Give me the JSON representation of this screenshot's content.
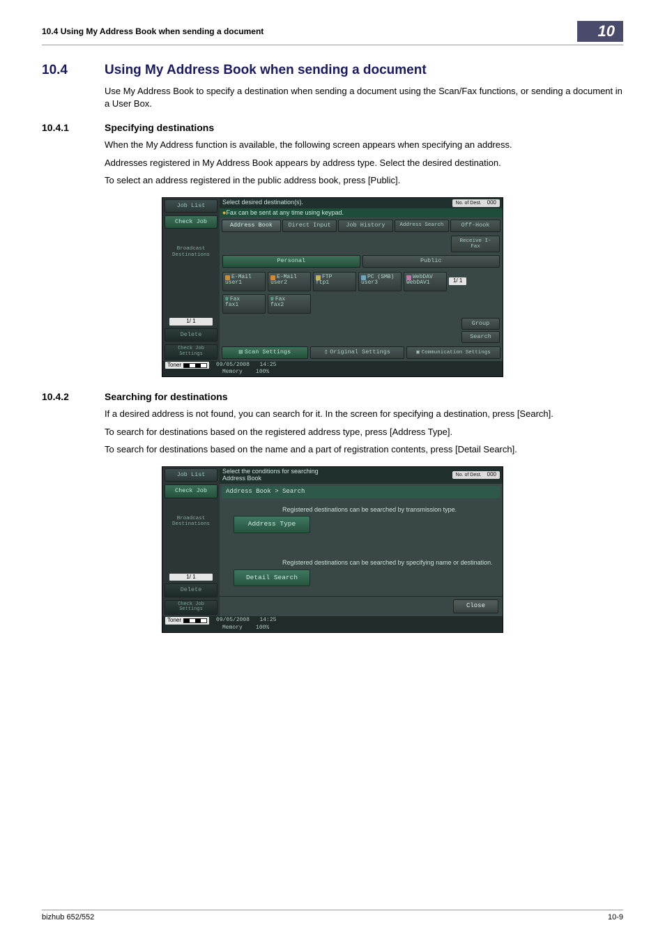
{
  "header": {
    "left": "10.4    Using My Address Book when sending a document",
    "badge": "10"
  },
  "section": {
    "num": "10.4",
    "title": "Using My Address Book when sending a document",
    "intro": "Use My Address Book to specify a destination when sending a document using the Scan/Fax functions, or sending a document in a User Box."
  },
  "sub1": {
    "num": "10.4.1",
    "title": "Specifying destinations",
    "p1": "When the My Address function is available, the following screen appears when specifying an address.",
    "p2": "Addresses registered in My Address Book appears by address type. Select the desired destination.",
    "p3": "To select an address registered in the public address book, press [Public]."
  },
  "screen1": {
    "topline": "Select desired destination(s).",
    "destLabel": "No. of Dest.",
    "destCount": "000",
    "banner": "Fax can be sent at any time using keypad.",
    "sidebar": {
      "jobList": "Job List",
      "checkJob": "Check Job",
      "broadcast": "Broadcast Destinations",
      "page": "1/  1",
      "delete": "Delete",
      "checkJobSettings": "Check Job Settings"
    },
    "tabs": {
      "addressBook": "Address Book",
      "directInput": "Direct Input",
      "jobHistory": "Job History",
      "addressSearch": "Address Search",
      "offHook": "Off-Hook"
    },
    "receive": "Receive I-Fax",
    "personal": "Personal",
    "public": "Public",
    "chips": {
      "email1a": "E-Mail",
      "email1b": "user1",
      "email2a": "E-Mail",
      "email2b": "user2",
      "ftp1a": "FTP",
      "ftp1b": "ftp1",
      "pc1a": "PC (SMB)",
      "pc1b": "user3",
      "web1a": "WebDAV",
      "web1b": "WebDAV1",
      "fax1a": "Fax",
      "fax1b": "fax1",
      "fax2a": "Fax",
      "fax2b": "fax2"
    },
    "pager": "1/  1",
    "group": "Group",
    "search": "Search",
    "scanSettings": "Scan Settings",
    "originalSettings": "Original Settings",
    "commSettings": "Communication Settings",
    "date": "09/05/2008",
    "time": "14:25",
    "memoryLabel": "Memory",
    "memoryPct": "100%",
    "toner": "Toner"
  },
  "sub2": {
    "num": "10.4.2",
    "title": "Searching for destinations",
    "p1": "If a desired address is not found, you can search for it. In the screen for specifying a destination, press [Search].",
    "p2": "To search for destinations based on the registered address type, press [Address Type].",
    "p3": "To search for destinations based on the name and a part of registration contents, press [Detail Search]."
  },
  "screen2": {
    "topline1": "Select the conditions for searching",
    "topline2": "Address Book",
    "breadcrumb": "Address Book > Search",
    "info1": "Registered destinations can be searched by transmission type.",
    "addressType": "Address Type",
    "info2": "Registered destinations can be searched by specifying name or destination.",
    "detailSearch": "Detail Search",
    "close": "Close"
  },
  "footer": {
    "left": "bizhub 652/552",
    "right": "10-9"
  }
}
